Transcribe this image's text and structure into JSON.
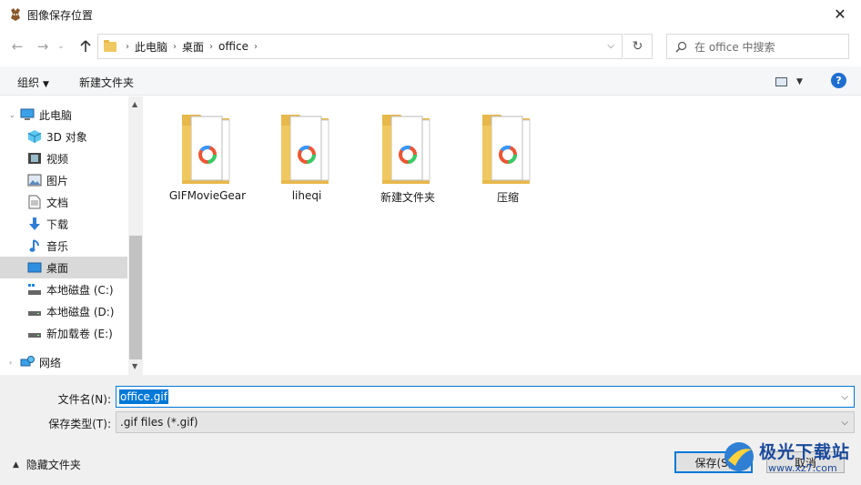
{
  "window": {
    "title": "图像保存位置",
    "close_glyph": "✕"
  },
  "address": {
    "crumbs": [
      "此电脑",
      "桌面",
      "office"
    ],
    "search_placeholder": "在 office 中搜索"
  },
  "toolbar": {
    "organize_label": "组织",
    "new_folder_label": "新建文件夹",
    "help_label": "?"
  },
  "nav": {
    "items": [
      {
        "label": "此电脑",
        "icon": "computer-icon"
      },
      {
        "label": "3D 对象",
        "icon": "3d-objects-icon"
      },
      {
        "label": "视频",
        "icon": "video-icon"
      },
      {
        "label": "图片",
        "icon": "pictures-icon"
      },
      {
        "label": "文档",
        "icon": "documents-icon"
      },
      {
        "label": "下载",
        "icon": "download-icon"
      },
      {
        "label": "音乐",
        "icon": "music-icon"
      },
      {
        "label": "桌面",
        "icon": "desktop-icon",
        "selected": true
      },
      {
        "label": "本地磁盘 (C:)",
        "icon": "drive-c-icon"
      },
      {
        "label": "本地磁盘 (D:)",
        "icon": "drive-icon"
      },
      {
        "label": "新加载卷 (E:)",
        "icon": "drive-icon"
      },
      {
        "label": "网络",
        "icon": "network-icon"
      }
    ]
  },
  "folders": [
    {
      "label": "GIFMovieGear"
    },
    {
      "label": "liheqi"
    },
    {
      "label": "新建文件夹"
    },
    {
      "label": "压缩"
    }
  ],
  "form": {
    "filename_label": "文件名(N):",
    "filename_value": "office.gif",
    "filetype_label": "保存类型(T):",
    "filetype_value": ".gif files (*.gif)",
    "hide_folders_label": "隐藏文件夹",
    "save_label": "保存(S)",
    "cancel_label": "取消"
  },
  "watermark": {
    "text": "极光下载站",
    "url": "www.xz7.com"
  },
  "colors": {
    "accent": "#0078d7",
    "folder": "#f0c862",
    "selected_nav": "#d9d9d9"
  }
}
